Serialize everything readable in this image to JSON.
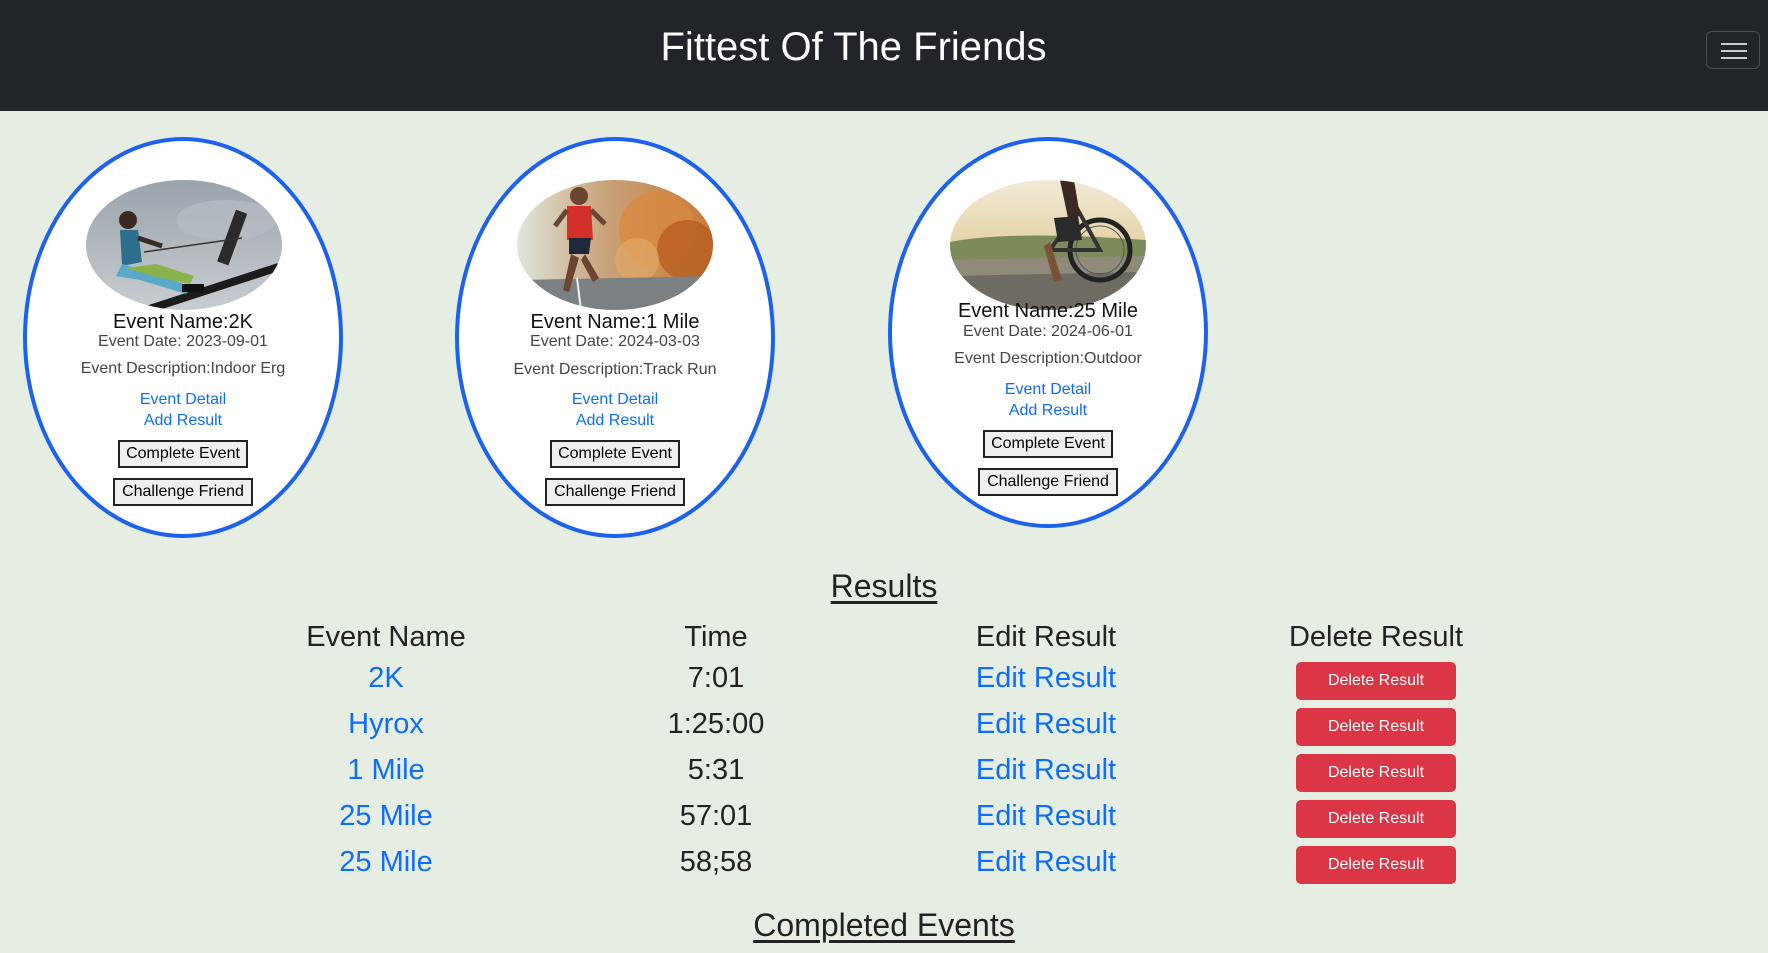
{
  "app": {
    "title": "Fittest Of The Friends"
  },
  "events": [
    {
      "name_label": "Event Name:2K",
      "date_label": "Event Date: 2023-09-01",
      "description_label": "Event Description:Indoor Erg",
      "detail_link": "Event Detail",
      "add_result_link": "Add Result",
      "complete_button": "Complete Event",
      "challenge_button": "Challenge Friend",
      "image_icon": "rowing-photo"
    },
    {
      "name_label": "Event Name:1 Mile",
      "date_label": "Event Date: 2024-03-03",
      "description_label": "Event Description:Track Run",
      "detail_link": "Event Detail",
      "add_result_link": "Add Result",
      "complete_button": "Complete Event",
      "challenge_button": "Challenge Friend",
      "image_icon": "running-photo"
    },
    {
      "name_label": "Event Name:25 Mile",
      "date_label": "Event Date: 2024-06-01",
      "description_label": "Event Description:Outdoor",
      "detail_link": "Event Detail",
      "add_result_link": "Add Result",
      "complete_button": "Complete Event",
      "challenge_button": "Challenge Friend",
      "image_icon": "cycling-photo"
    }
  ],
  "results": {
    "title": "Results",
    "headers": {
      "event_name": "Event Name",
      "time": "Time",
      "edit": "Edit Result",
      "delete": "Delete Result"
    },
    "rows": [
      {
        "event": "2K",
        "time": "7:01",
        "edit": "Edit Result",
        "delete": "Delete Result"
      },
      {
        "event": "Hyrox",
        "time": "1:25:00",
        "edit": "Edit Result",
        "delete": "Delete Result"
      },
      {
        "event": "1 Mile",
        "time": "5:31",
        "edit": "Edit Result",
        "delete": "Delete Result"
      },
      {
        "event": "25 Mile",
        "time": "57:01",
        "edit": "Edit Result",
        "delete": "Delete Result"
      },
      {
        "event": "25 Mile",
        "time": "58;58",
        "edit": "Edit Result",
        "delete": "Delete Result"
      }
    ]
  },
  "completed": {
    "title": "Completed Events"
  },
  "colors": {
    "navbar": "#212529",
    "page_background": "#e6ede2",
    "card_border": "#1d62ee",
    "link": "#0d6efd",
    "danger": "#dc3545"
  }
}
